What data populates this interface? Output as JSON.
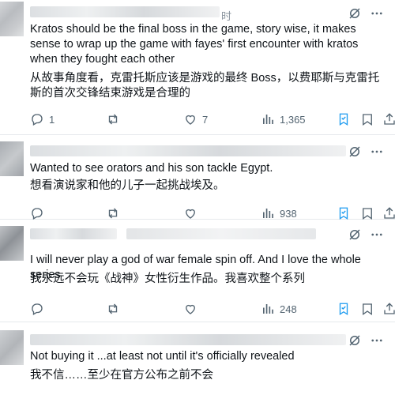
{
  "tweets": [
    {
      "time_fragment": "时",
      "text_en": "Kratos should be the final boss in the game, story wise, it makes sense to wrap up the game with fayes' first encounter with kratos when they fought each other",
      "text_zh": "从故事角度看，克雷托斯应该是游戏的最终 Boss，以费耶斯与克雷托斯的首次交锋结束游戏是合理的",
      "replies": "1",
      "reposts": "",
      "likes": "7",
      "views": "1,365"
    },
    {
      "text_en": "Wanted to see orators and his son tackle Egypt.",
      "text_zh": "想看演说家和他的儿子一起挑战埃及。",
      "replies": "",
      "reposts": "",
      "likes": "",
      "views": "938"
    },
    {
      "text_en": "I will never play a god of war female spin off. And I love the whole series",
      "text_zh": "我永远不会玩《战神》女性衍生作品。我喜欢整个系列",
      "replies": "",
      "reposts": "",
      "likes": "",
      "views": "248"
    },
    {
      "text_en": "Not buying it ...at least not until it's officially revealed",
      "text_zh": "我不信……至少在官方公布之前不会"
    }
  ],
  "icons": {
    "grok": "grok-icon",
    "more": "more-icon",
    "reply": "reply-icon",
    "repost": "repost-icon",
    "like": "heart-icon",
    "views": "views-icon",
    "bookmark": "bookmark-icon",
    "share": "share-icon"
  },
  "colors": {
    "text": "#0f1419",
    "muted": "#536471",
    "bookmark_accent": "#1d9bf0"
  }
}
